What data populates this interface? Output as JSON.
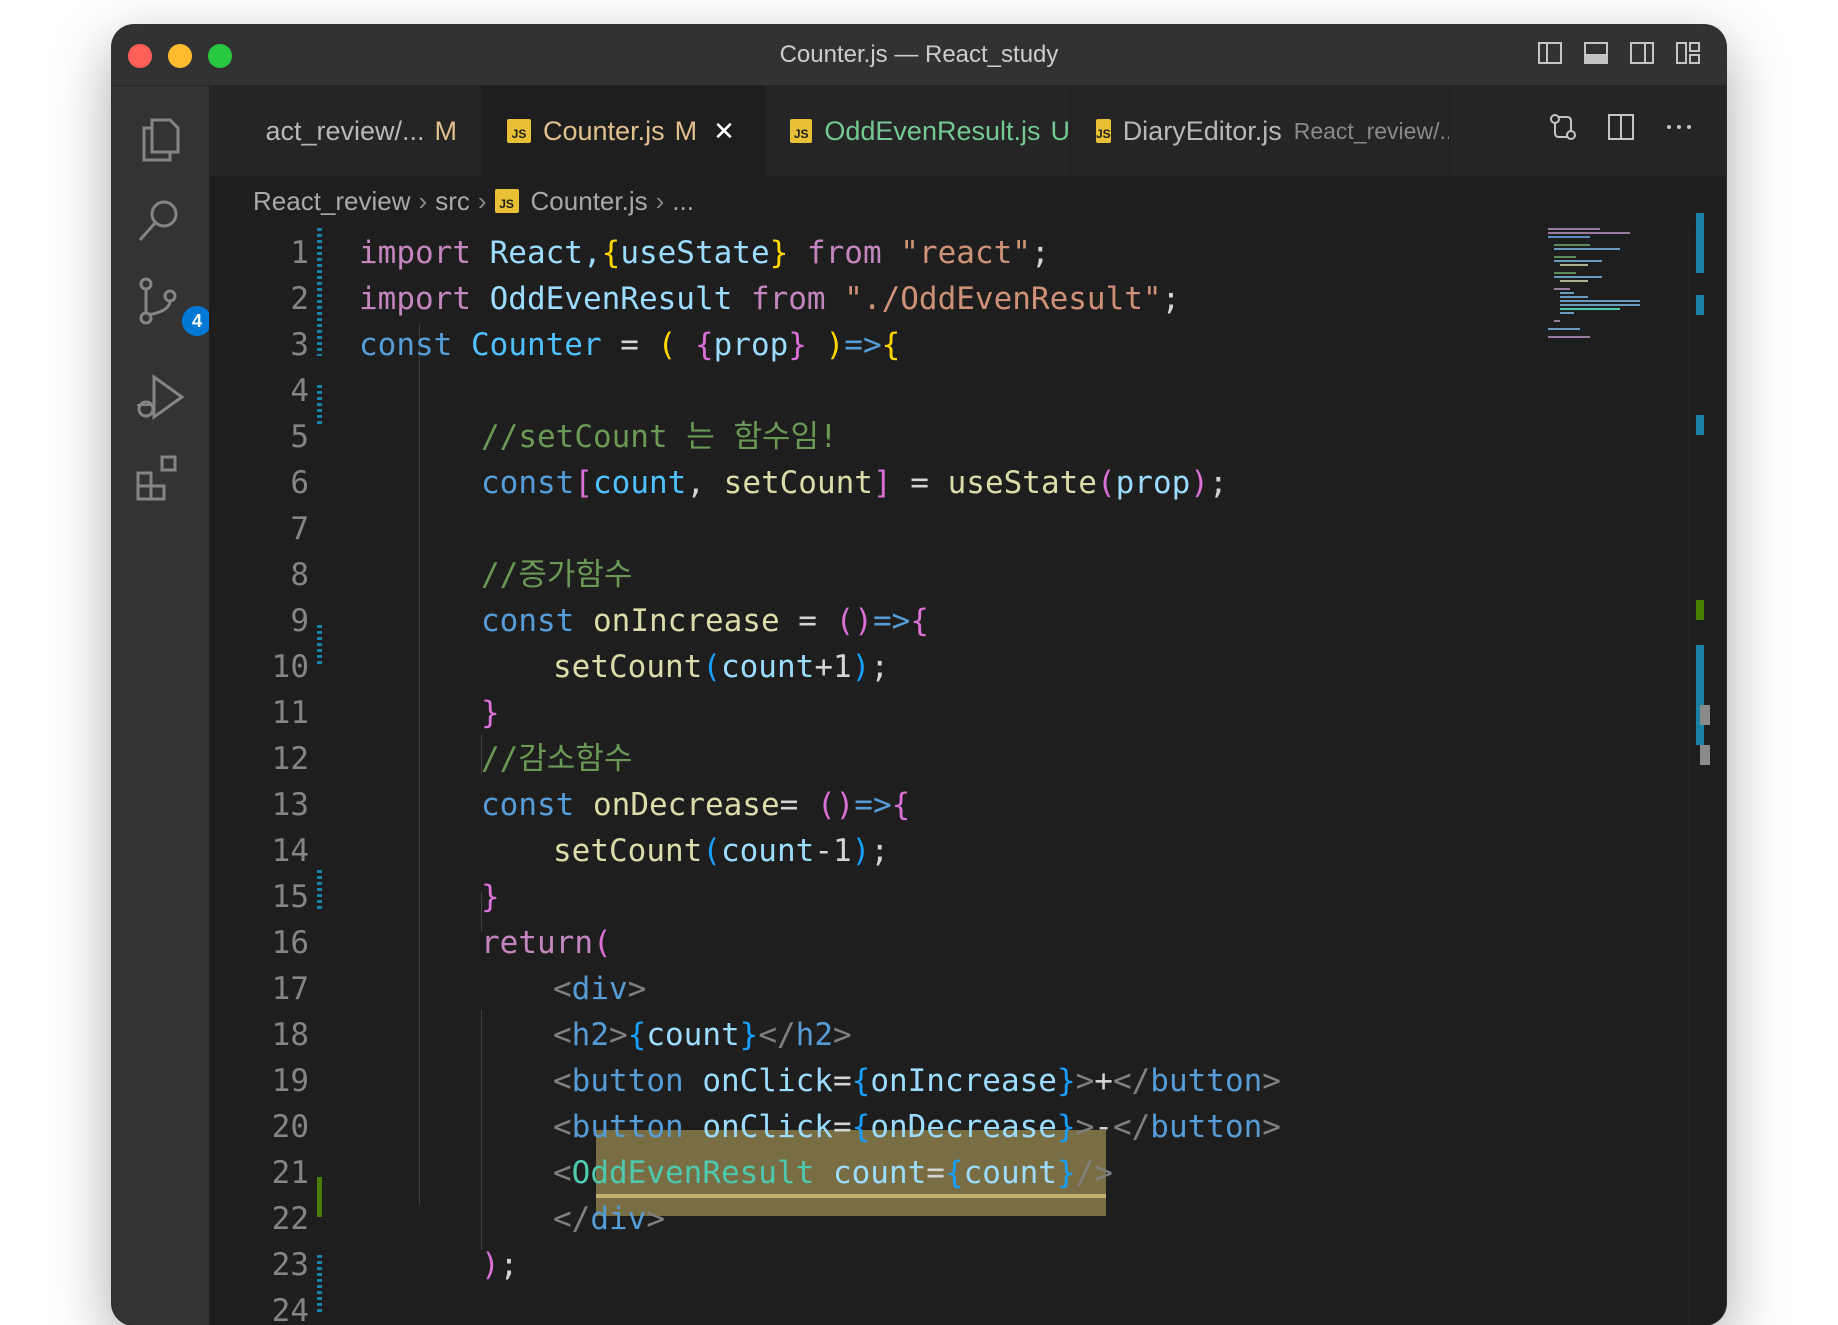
{
  "window": {
    "title": "Counter.js — React_study"
  },
  "activity": {
    "scm_badge": "4"
  },
  "tabs": [
    {
      "name": "act_review/...",
      "status": "M"
    },
    {
      "name": "Counter.js",
      "status": "M",
      "close": "✕"
    },
    {
      "name": "OddEvenResult.js",
      "status": "U"
    },
    {
      "name": "DiaryEditor.js",
      "desc": "React_review/..."
    }
  ],
  "breadcrumb": {
    "root": "React_review",
    "folder": "src",
    "file": "Counter.js",
    "more": "..."
  },
  "editor": {
    "line_numbers": [
      "1",
      "2",
      "3",
      "4",
      "5",
      "6",
      "7",
      "8",
      "9",
      "10",
      "11",
      "12",
      "13",
      "14",
      "15",
      "16",
      "17",
      "18",
      "19",
      "20",
      "21",
      "22",
      "23",
      "24"
    ],
    "tokens": {
      "l1": [
        "import",
        " React,",
        "{",
        "useState",
        "}",
        " from",
        " \"react\"",
        ";"
      ],
      "l2": [
        "import",
        " OddEvenResult",
        " from",
        " \"./OddEvenResult\"",
        ";"
      ],
      "l3": [
        "const",
        " Counter",
        " = ",
        "(",
        " {",
        "prop",
        "}",
        " )",
        "=>",
        "{"
      ],
      "l5": [
        "//setCount 는 함수임!"
      ],
      "l6": [
        "const",
        "[",
        "count",
        ", ",
        "setCount",
        "]",
        " = ",
        "useState",
        "(",
        "prop",
        ")",
        ";"
      ],
      "l8": [
        "//증가함수"
      ],
      "l9": [
        "const",
        " onIncrease",
        " = ",
        "()",
        "=>",
        "{"
      ],
      "l10": [
        "setCount",
        "(",
        "count",
        "+1",
        ")",
        ";"
      ],
      "l11": [
        "}"
      ],
      "l12": [
        "//감소함수"
      ],
      "l13": [
        "const",
        " onDecrease",
        "= ",
        "()",
        "=>",
        "{"
      ],
      "l14": [
        "setCount",
        "(",
        "count",
        "-1",
        ")",
        ";"
      ],
      "l15": [
        "}"
      ],
      "l16": [
        "return",
        "("
      ],
      "l17": [
        "<",
        "div",
        ">"
      ],
      "l18": [
        "<",
        "h2",
        ">",
        "{",
        "count",
        "}",
        "</",
        "h2",
        ">"
      ],
      "l19": [
        "<",
        "button",
        " onClick",
        "=",
        "{",
        "onIncrease",
        "}",
        ">",
        "+",
        "</",
        "button",
        ">"
      ],
      "l20": [
        "<",
        "button",
        " onClick",
        "=",
        "{",
        "onDecrease",
        "}",
        ">",
        "-",
        "</",
        "button",
        ">"
      ],
      "l21": [
        "<",
        "OddEvenResult",
        " count",
        "=",
        "{",
        "count",
        "}",
        "/>"
      ],
      "l22": [
        "</",
        "div",
        ">"
      ],
      "l23": [
        ")",
        ";"
      ]
    }
  },
  "colors": {
    "keyword": "#c586c0",
    "storage": "#569cd6",
    "function": "#dcdcaa",
    "variable": "#9cdcfe",
    "string": "#ce9178",
    "comment": "#6a9955",
    "component": "#4ec9b0",
    "modified": "#1b81a8",
    "added": "#487e02"
  }
}
